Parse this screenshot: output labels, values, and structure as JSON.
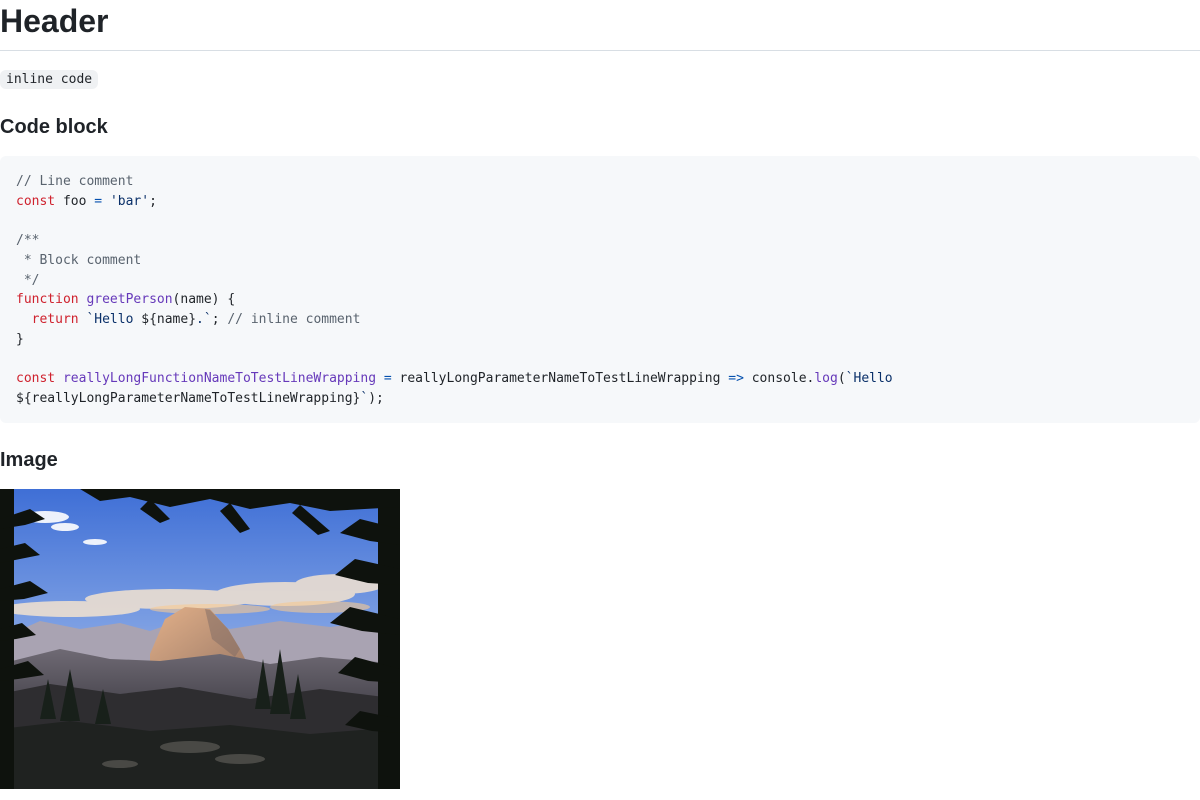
{
  "header": {
    "title": "Header"
  },
  "inline": {
    "code": "inline code"
  },
  "sections": {
    "code_block_title": "Code block",
    "image_title": "Image"
  },
  "code": {
    "l1_comment": "// Line comment",
    "l2_const": "const",
    "l2_rest_a": " foo ",
    "l2_eq": "=",
    "l2_space": " ",
    "l2_str": "'bar'",
    "l2_semi": ";",
    "l4": "/**",
    "l5": " * Block comment",
    "l6": " */",
    "l7_kw": "function",
    "l7_space": " ",
    "l7_fn": "greetPerson",
    "l7_rest": "(name) {",
    "l8_indent": "  ",
    "l8_kw": "return",
    "l8_space": " ",
    "l8_str": "`Hello ",
    "l8_interp": "${name}",
    "l8_str2": ".`",
    "l8_semi": "; ",
    "l8_comment": "// inline comment",
    "l9": "}",
    "l11_kw": "const",
    "l11_space": " ",
    "l11_fn": "reallyLongFunctionNameToTestLineWrapping",
    "l11_space2": " ",
    "l11_eq": "=",
    "l11_param": " reallyLongParameterNameToTestLineWrapping ",
    "l11_arrow": "=>",
    "l11_console": " console.",
    "l11_log": "log",
    "l11_paren": "(",
    "l11_str": "`Hello ",
    "l12_interp": "${reallyLongParameterNameToTestLineWrapping}",
    "l12_str": "`",
    "l12_end": ");"
  },
  "colors": {
    "comment": "#59636e",
    "keyword": "#cf222e",
    "string": "#0a3069",
    "function": "#6639ba",
    "operator": "#0550ae",
    "code_bg": "#f6f8fa",
    "inline_code_bg": "#eff1f3"
  }
}
